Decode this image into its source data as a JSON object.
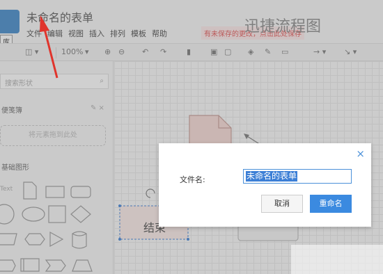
{
  "app": {
    "logo_tooltip": "库",
    "document_title": "未命名的表单",
    "brand": "迅捷流程图",
    "unsaved_notice": "有未保存的更改，点击此处保存",
    "menu": [
      "文件",
      "编辑",
      "视图",
      "插入",
      "排列",
      "模板",
      "帮助"
    ],
    "zoom": "100%"
  },
  "sidebar": {
    "search_placeholder": "搜索形状",
    "scratchpad_title": "便笺簿",
    "drop_hint": "将元素拖到此处",
    "general_title": "基础图形",
    "text_shape_label": "Text"
  },
  "canvas": {
    "node_label": "结束"
  },
  "dialog": {
    "close_glyph": "×",
    "filename_label": "文件名:",
    "filename_value": "未命名的表单",
    "cancel_label": "取消",
    "rename_label": "重命名"
  },
  "colors": {
    "accent": "#3b8ae0",
    "selection": "#3c7fd6",
    "unsaved_text": "#e05050",
    "annotation_arrow": "#e0342c"
  }
}
